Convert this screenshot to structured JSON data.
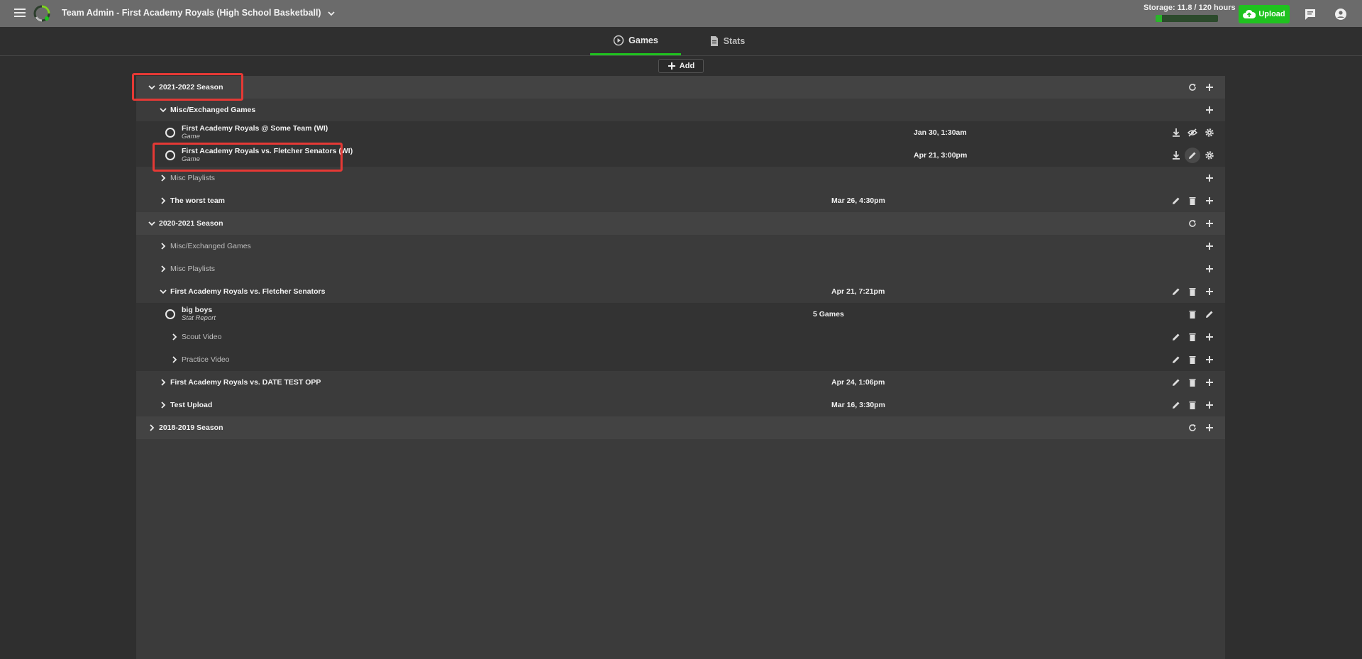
{
  "header": {
    "title": "Team Admin - First Academy Royals (High School Basketball)",
    "storage_label": "Storage: 11.8 / 120 hours",
    "storage_fraction": 0.098,
    "upload_label": "Upload",
    "icons": [
      "menu-icon",
      "logo",
      "chevron-down-icon",
      "cloud-upload-icon",
      "chat-icon",
      "account-icon"
    ]
  },
  "tabs": [
    {
      "label": "Games",
      "active": true
    },
    {
      "label": "Stats",
      "active": false
    }
  ],
  "add_label": "Add",
  "tree": {
    "s1": {
      "label": "2021-2022 Season"
    },
    "s1_misc": {
      "label": "Misc/Exchanged Games"
    },
    "s1_g1": {
      "title": "First Academy Royals @ Some Team (WI)",
      "type": "Game",
      "date": "Jan 30, 1:30am"
    },
    "s1_g2": {
      "title": "First Academy Royals vs. Fletcher Senators (WI)",
      "type": "Game",
      "date": "Apr 21, 3:00pm"
    },
    "s1_playlists": {
      "label": "Misc Playlists"
    },
    "s1_worst": {
      "label": "The worst team",
      "date": "Mar 26, 4:30pm"
    },
    "s2": {
      "label": "2020-2021 Season"
    },
    "s2_misc": {
      "label": "Misc/Exchanged Games"
    },
    "s2_playlists": {
      "label": "Misc Playlists"
    },
    "s2_fletcher": {
      "label": "First Academy Royals vs. Fletcher Senators",
      "date": "Apr 21, 7:21pm"
    },
    "s2_bigboys": {
      "title": "big boys",
      "type": "Stat Report",
      "count": "5 Games"
    },
    "s2_scout": {
      "label": "Scout Video"
    },
    "s2_practice": {
      "label": "Practice Video"
    },
    "s2_datetest": {
      "label": "First Academy Royals vs. DATE TEST OPP",
      "date": "Apr 24, 1:06pm"
    },
    "s2_testupload": {
      "label": "Test Upload",
      "date": "Mar 16, 3:30pm"
    },
    "s3": {
      "label": "2018-2019 Season"
    }
  },
  "colors": {
    "accent": "#1fc21f",
    "highlight": "#e53935",
    "topbar": "#6b6b6b",
    "background": "#2f2f2f"
  }
}
